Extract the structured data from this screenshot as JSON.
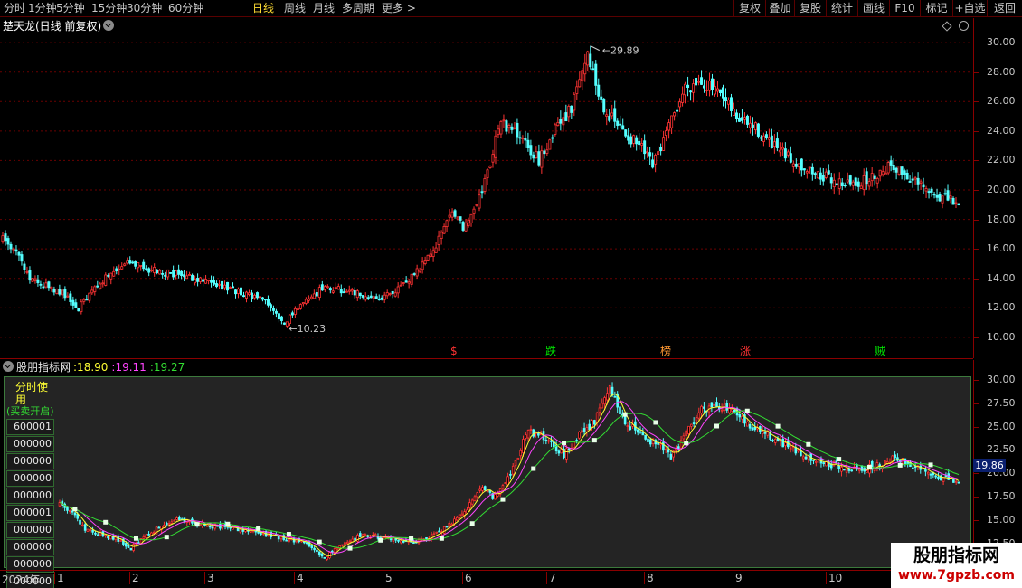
{
  "toolbar": {
    "periods": [
      "分时",
      "1分钟",
      "5分钟",
      "15分钟",
      "30分钟",
      "60分钟",
      "日线",
      "周线",
      "月线",
      "多周期",
      "更多 >"
    ],
    "active_period": "日线",
    "tools": [
      "复权",
      "叠加",
      "复股",
      "统计",
      "画线",
      "F10",
      "标记",
      "+自选",
      "返回"
    ]
  },
  "main_panel": {
    "title": "楚天龙(日线 前复权)",
    "high_label": "29.89",
    "low_label": "10.23",
    "y_ticks": [
      "30.00",
      "28.00",
      "26.00",
      "24.00",
      "22.00",
      "20.00",
      "18.00",
      "16.00",
      "14.00",
      "12.00",
      "10.00"
    ],
    "signals": [
      {
        "text": "$",
        "color": "#ff3333"
      },
      {
        "text": "跌",
        "color": "#00e000"
      },
      {
        "text": "榜",
        "color": "#ff9933"
      },
      {
        "text": "涨",
        "color": "#ff3333"
      },
      {
        "text": "贼",
        "color": "#00e000"
      }
    ]
  },
  "indicator_panel": {
    "name": "股朋指标网",
    "values": [
      {
        "text": ":18.90",
        "color": "#ffff33"
      },
      {
        "text": ":19.11",
        "color": "#ff44ff"
      },
      {
        "text": ":19.27",
        "color": "#33dd33"
      }
    ],
    "legend_title": "分时使用",
    "legend_subtitle": "(买卖开启)",
    "legend_rows": [
      "600001",
      "000000",
      "000000",
      "000000",
      "000000",
      "000001",
      "000000",
      "000000",
      "000000",
      "000000"
    ],
    "y_ticks": [
      "30.00",
      "27.50",
      "25.00",
      "22.50",
      "20.00",
      "17.50",
      "15.00",
      "12.50"
    ],
    "current_price": "19.86"
  },
  "xaxis": {
    "labels": [
      "2024年",
      "1",
      "2",
      "3",
      "4",
      "5",
      "6",
      "7",
      "8",
      "9",
      "10"
    ]
  },
  "watermark": {
    "title": "股朋指标网",
    "url": "www.7gpzb.com"
  },
  "colors": {
    "up": "#ff3333",
    "down": "#54ffff",
    "ma_fast": "#ffff33",
    "ma_mid": "#ff44ff",
    "ma_slow": "#33dd33"
  },
  "chart_data": {
    "type": "candlestick",
    "title": "楚天龙(日线 前复权)",
    "x_months": [
      "1",
      "2",
      "3",
      "4",
      "5",
      "6",
      "7",
      "8",
      "9",
      "10"
    ],
    "ylim": [
      9.5,
      30.5
    ],
    "annotations": {
      "max": 29.89,
      "min": 10.23
    },
    "close_trajectory": [
      [
        0,
        16.6
      ],
      [
        4,
        16.2
      ],
      [
        10,
        14.0
      ],
      [
        22,
        13.0
      ],
      [
        28,
        12.0
      ],
      [
        34,
        13.5
      ],
      [
        45,
        15.0
      ],
      [
        60,
        14.4
      ],
      [
        72,
        14.0
      ],
      [
        85,
        13.2
      ],
      [
        96,
        12.5
      ],
      [
        104,
        11.0
      ],
      [
        110,
        12.2
      ],
      [
        118,
        13.3
      ],
      [
        128,
        13.2
      ],
      [
        140,
        12.6
      ],
      [
        148,
        13.5
      ],
      [
        158,
        15.5
      ],
      [
        166,
        18.6
      ],
      [
        170,
        17.5
      ],
      [
        176,
        19.5
      ],
      [
        184,
        24.5
      ],
      [
        192,
        23.5
      ],
      [
        198,
        22.0
      ],
      [
        204,
        24.0
      ],
      [
        210,
        25.5
      ],
      [
        216,
        29.4
      ],
      [
        220,
        26.5
      ],
      [
        224,
        25.0
      ],
      [
        230,
        23.8
      ],
      [
        236,
        22.8
      ],
      [
        240,
        21.6
      ],
      [
        246,
        24.2
      ],
      [
        252,
        27.0
      ],
      [
        258,
        27.5
      ],
      [
        264,
        26.5
      ],
      [
        272,
        24.8
      ],
      [
        278,
        24.2
      ],
      [
        284,
        23.0
      ],
      [
        290,
        22.2
      ],
      [
        300,
        21.1
      ],
      [
        308,
        20.6
      ],
      [
        314,
        20.4
      ],
      [
        320,
        20.7
      ],
      [
        328,
        21.8
      ],
      [
        334,
        20.9
      ],
      [
        342,
        19.8
      ],
      [
        350,
        19.3
      ],
      [
        353,
        18.9
      ]
    ]
  }
}
